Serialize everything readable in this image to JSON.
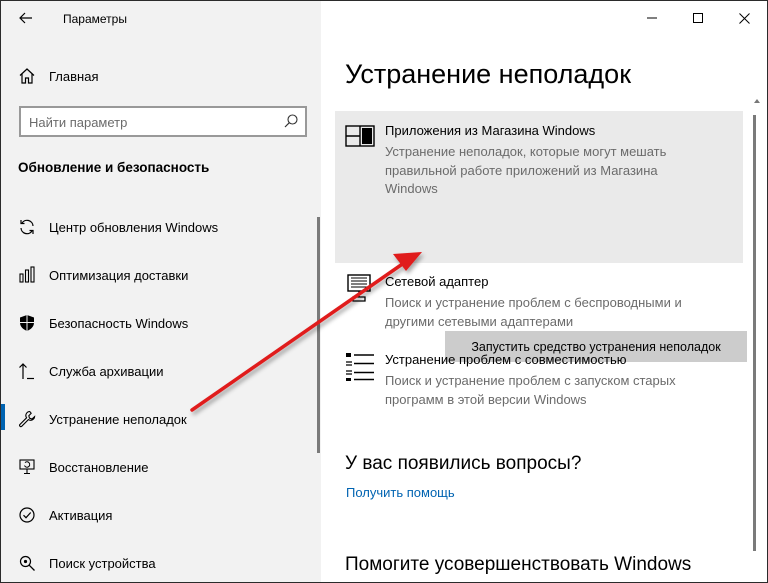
{
  "window": {
    "title": "Параметры"
  },
  "sidebar": {
    "home_label": "Главная",
    "search_placeholder": "Найти параметр",
    "section_title": "Обновление и безопасность",
    "items": [
      {
        "label": "Центр обновления Windows",
        "icon": "sync-icon"
      },
      {
        "label": "Оптимизация доставки",
        "icon": "delivery-icon"
      },
      {
        "label": "Безопасность Windows",
        "icon": "shield-icon"
      },
      {
        "label": "Служба архивации",
        "icon": "backup-icon"
      },
      {
        "label": "Устранение неполадок",
        "icon": "wrench-icon",
        "active": true
      },
      {
        "label": "Восстановление",
        "icon": "recovery-icon"
      },
      {
        "label": "Активация",
        "icon": "activation-icon"
      },
      {
        "label": "Поиск устройства",
        "icon": "find-device-icon"
      }
    ]
  },
  "main": {
    "page_title": "Устранение неполадок",
    "troubleshooters": [
      {
        "name": "Приложения из Магазина Windows",
        "description": "Устранение неполадок, которые могут мешать правильной работе приложений из Магазина Windows",
        "icon": "store-apps-icon"
      },
      {
        "name": "Сетевой адаптер",
        "description": "Поиск и устранение проблем с беспроводными и другими сетевыми адаптерами",
        "icon": "network-adapter-icon"
      },
      {
        "name": "Устранение проблем с совместимостью",
        "description": "Поиск и устранение проблем с запуском старых программ в этой версии Windows",
        "icon": "compatibility-icon"
      }
    ],
    "run_button_label": "Запустить средство устранения неполадок",
    "questions_title": "У вас появились вопросы?",
    "help_link": "Получить помощь",
    "improve_title": "Помогите усовершенствовать Windows"
  },
  "colors": {
    "accent": "#0063b1",
    "annotation_arrow": "#e01b1b",
    "sidebar_bg": "#f2f2f2",
    "card_bg": "#eaeaea",
    "button_bg": "#cccccc"
  }
}
